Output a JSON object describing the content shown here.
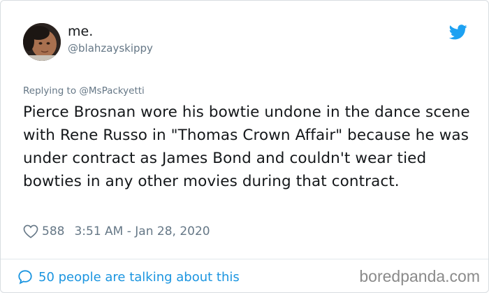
{
  "author": {
    "display_name": "me.",
    "handle": "@blahzayskippy"
  },
  "reply_to": {
    "text": "Replying to @MsPackyetti"
  },
  "tweet": {
    "text": "Pierce Brosnan wore his bowtie undone in the dance scene with Rene Russo in \"Thomas Crown Affair\" because he was under contract as James Bond and couldn't wear tied bowties in any other movies during that contract."
  },
  "meta": {
    "likes": "588",
    "timestamp": "3:51 AM - Jan 28, 2020"
  },
  "footer": {
    "talking_text": "50 people are talking about this",
    "watermark": "boredpanda.com"
  },
  "icons": {
    "brand": "twitter-bird-icon",
    "like": "heart-icon",
    "conversation": "speech-bubble-icon"
  },
  "colors": {
    "twitter_blue": "#1da1f2",
    "link_blue": "#1b95e0",
    "muted_text": "#657786",
    "primary_text": "#14171a"
  }
}
